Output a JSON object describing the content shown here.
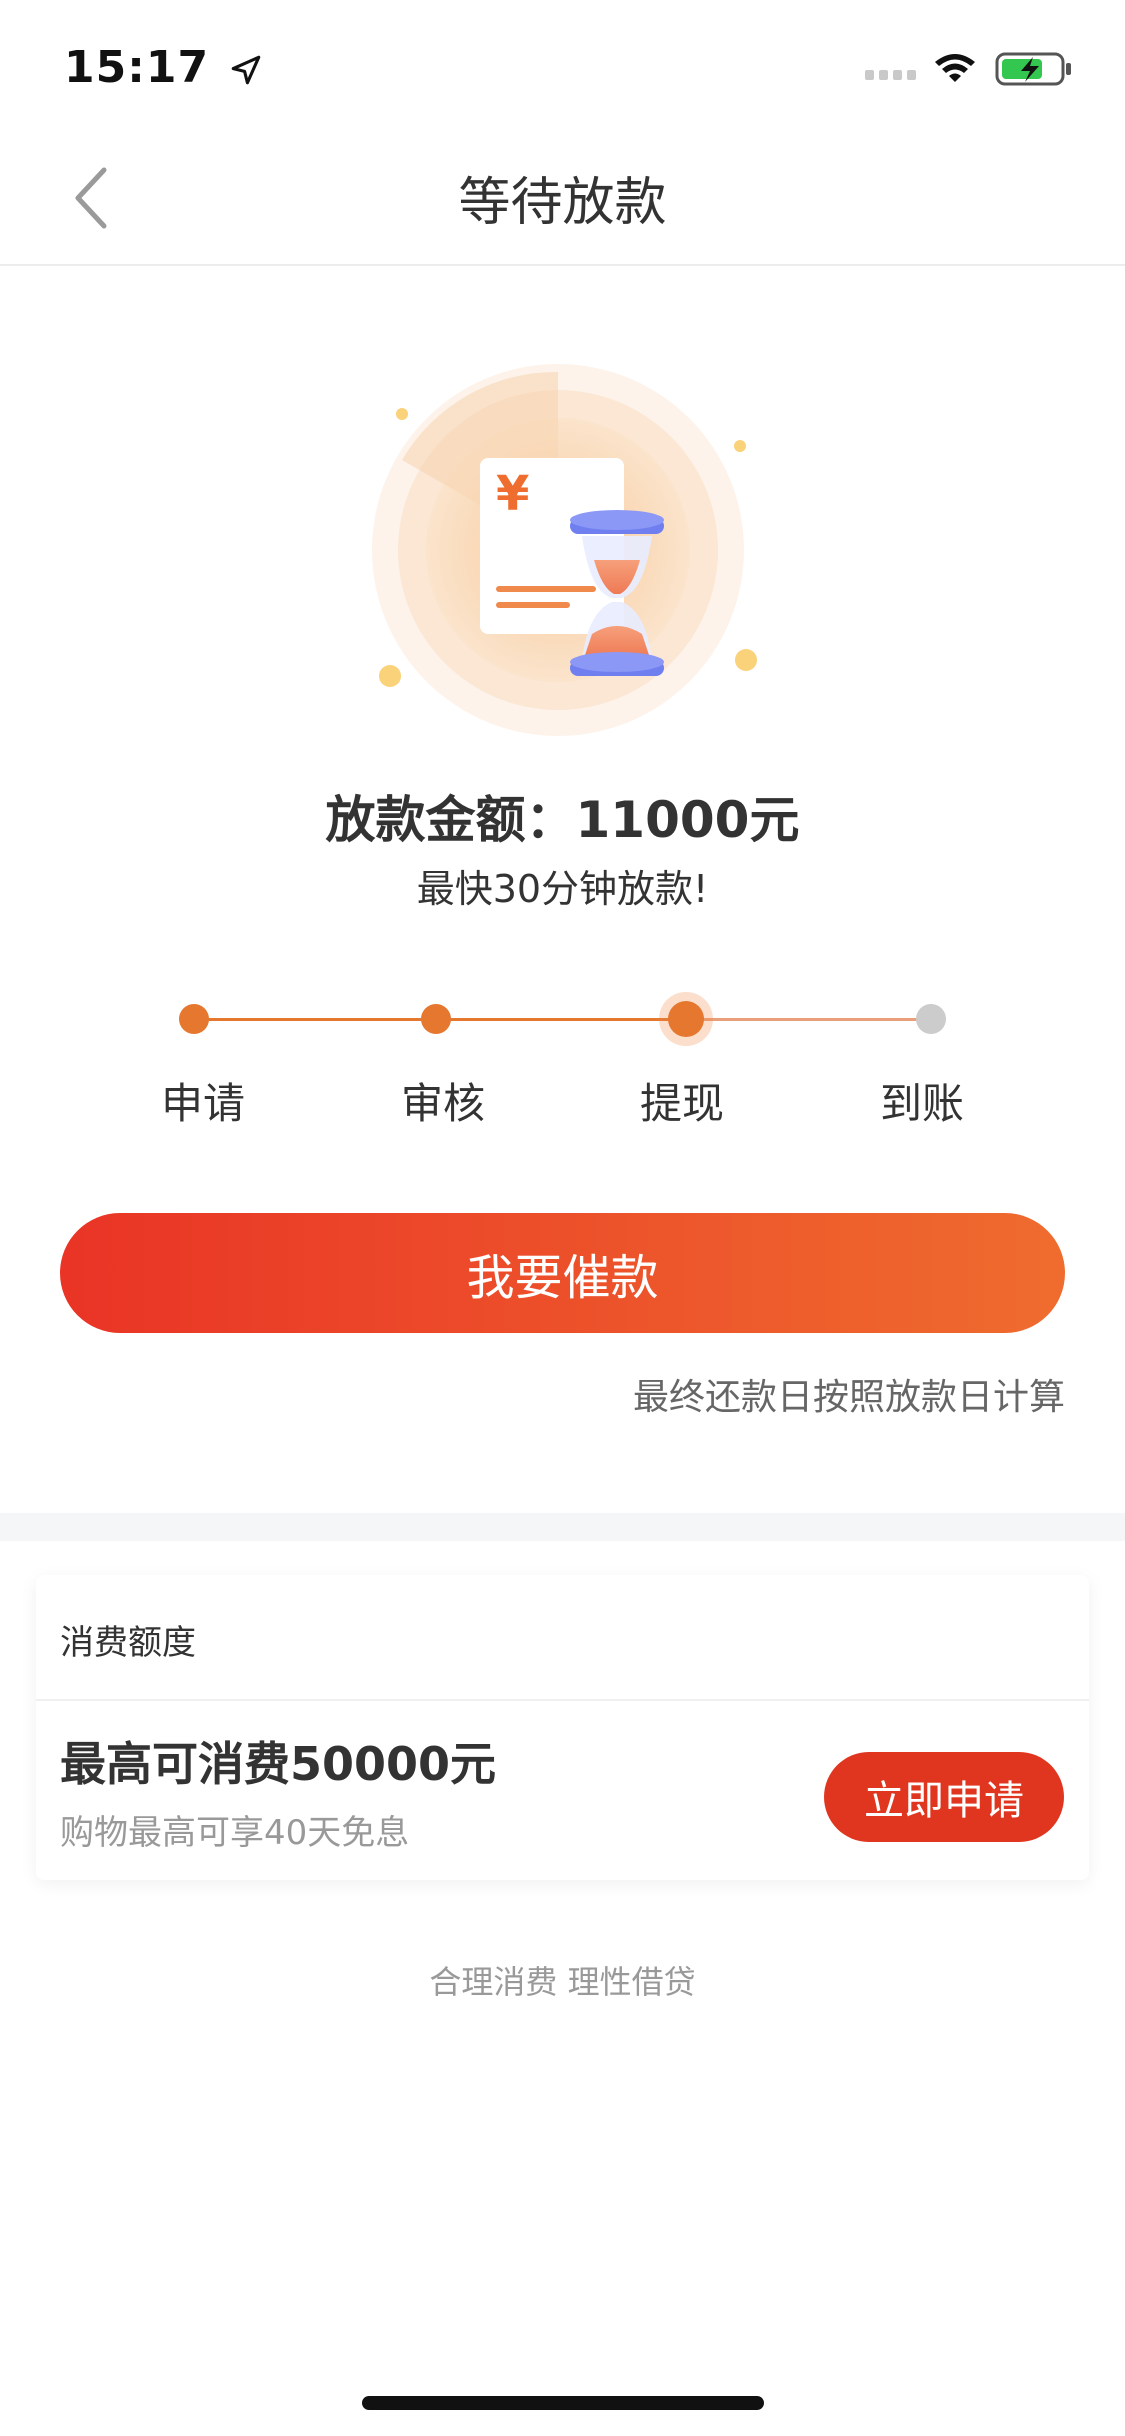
{
  "status_bar": {
    "time": "15:17",
    "icons": [
      "location-arrow-icon",
      "cellular-signal-icon",
      "wifi-icon",
      "battery-charging-icon"
    ]
  },
  "nav": {
    "title": "等待放款",
    "back_icon": "chevron-left-icon"
  },
  "hero": {
    "illustration": "hourglass-bill-icon",
    "currency_symbol": "¥"
  },
  "loan": {
    "amount_text": "放款金额：11000元",
    "speed_text": "最快30分钟放款!"
  },
  "steps": {
    "items": [
      {
        "label": "申请",
        "state": "done"
      },
      {
        "label": "审核",
        "state": "done"
      },
      {
        "label": "提现",
        "state": "current"
      },
      {
        "label": "到账",
        "state": "pending"
      }
    ],
    "colors": {
      "done": "#e5772f",
      "pending": "#cccccc"
    }
  },
  "actions": {
    "urge_label": "我要催款",
    "note": "最终还款日按照放款日计算"
  },
  "credit_card": {
    "title": "消费额度",
    "main": "最高可消费50000元",
    "sub": "购物最高可享40天免息",
    "apply_label": "立即申请"
  },
  "footer": {
    "slogan": "合理消费 理性借贷"
  },
  "colors": {
    "accent_red": "#e0361f",
    "accent_orange": "#ef6c2e",
    "step_orange": "#e5772f"
  }
}
